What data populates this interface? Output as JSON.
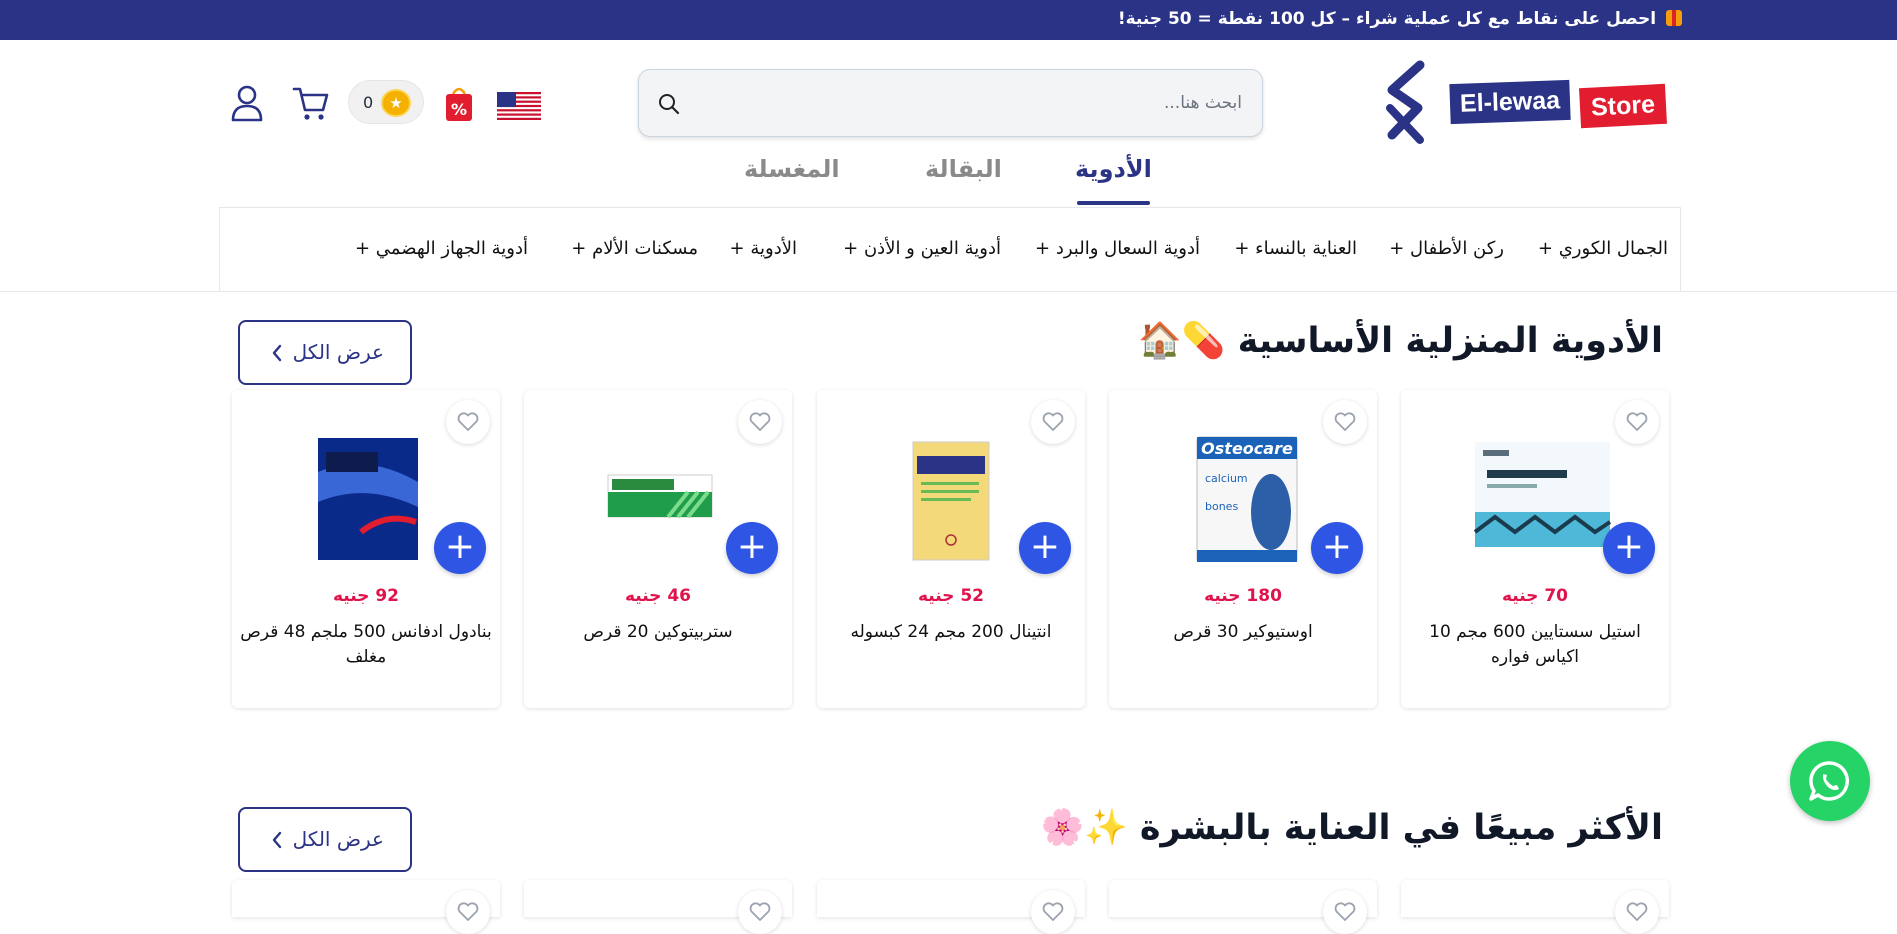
{
  "promo": {
    "text": "احصل على نقاط مع كل عملية شراء – كل 100 نقطة = 50 جنية!",
    "icon": "gift-icon"
  },
  "brand": {
    "name": "El-lewaa",
    "store": "Store",
    "colors": {
      "primary": "#2b3386",
      "accent": "#e11d2f"
    }
  },
  "search": {
    "placeholder": "ابحث هنا...",
    "value": ""
  },
  "header": {
    "points_count": "0",
    "icons": [
      "us-flag-icon",
      "offers-bag-icon",
      "points-coin-icon",
      "cart-icon",
      "user-icon"
    ]
  },
  "tabs": [
    {
      "label": "الأدوية",
      "active": true
    },
    {
      "label": "البقالة",
      "active": false
    },
    {
      "label": "المغسلة",
      "active": false
    }
  ],
  "categories": [
    "الجمال الكوري +",
    "ركن الأطفال +",
    "العناية بالنساء +",
    "أدوية السعال والبرد +",
    "أدوية العين و الأذن +",
    "الأدوية +",
    "مسكنات الألام +",
    "أدوية الجهاز الهضمي +"
  ],
  "sections": [
    {
      "title": "الأدوية المنزلية الأساسية 💊🏠",
      "view_all": "عرض الكل",
      "products": [
        {
          "name": "استيل سستايين 600 مجم 10 اكياس فواره",
          "price": "70 جنيه",
          "image": "acetylcistein-box"
        },
        {
          "name": "اوستيوكير 30 قرص",
          "price": "180 جنيه",
          "image": "osteocare-box"
        },
        {
          "name": "انتينال 200 مجم 24 كبسوله",
          "price": "52 جنيه",
          "image": "antinal-box"
        },
        {
          "name": "ستربيتوكين 20 قرص",
          "price": "46 جنيه",
          "image": "streptoquin-box"
        },
        {
          "name": "بنادول ادفانس 500 ملجم 48 قرص مغلف",
          "price": "92 جنيه",
          "image": "panadol-advance-box"
        }
      ]
    },
    {
      "title": "الأكثر مبيعًا في العناية بالبشرة ✨🌸",
      "view_all": "عرض الكل"
    }
  ],
  "whatsapp": {
    "icon": "whatsapp-icon",
    "color": "#25d366"
  }
}
